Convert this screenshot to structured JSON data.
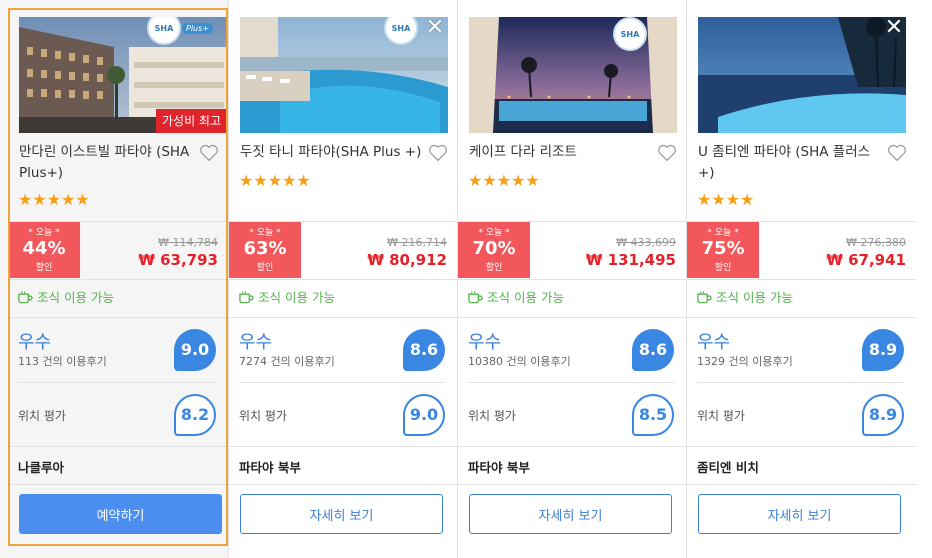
{
  "hotels": [
    {
      "name": "만다린 이스트빌 파타야 (SHA Plus+)",
      "stars": "★★★★★",
      "ribbon": "가성비 최고",
      "deal_today": "* 오늘 *",
      "deal_pct": "44%",
      "deal_off": "할인",
      "price_original": "₩ 114,784",
      "price_final": "₩ 63,793",
      "breakfast": "조식 이용 가능",
      "rating_word": "우수",
      "reviews": "113 건의 이용후기",
      "score": "9.0",
      "location_label": "위치 평가",
      "location_score": "8.2",
      "area": "나클루아",
      "button": "예약하기"
    },
    {
      "name": "두짓 타니 파타야(SHA Plus +)",
      "stars": "★★★★★",
      "deal_today": "* 오늘 *",
      "deal_pct": "63%",
      "deal_off": "할인",
      "price_original": "₩ 216,714",
      "price_final": "₩ 80,912",
      "breakfast": "조식 이용 가능",
      "rating_word": "우수",
      "reviews": "7274 건의 이용후기",
      "score": "8.6",
      "location_label": "위치 평가",
      "location_score": "9.0",
      "area": "파타야 북부",
      "button": "자세히 보기"
    },
    {
      "name": "케이프 다라 리조트",
      "stars": "★★★★★",
      "deal_today": "* 오늘 *",
      "deal_pct": "70%",
      "deal_off": "할인",
      "price_original": "₩ 433,699",
      "price_final": "₩ 131,495",
      "breakfast": "조식 이용 가능",
      "rating_word": "우수",
      "reviews": "10380 건의 이용후기",
      "score": "8.6",
      "location_label": "위치 평가",
      "location_score": "8.5",
      "area": "파타야 북부",
      "button": "자세히 보기"
    },
    {
      "name": "U 좀티엔 파타야 (SHA 플러스 +)",
      "stars": "★★★★",
      "deal_today": "* 오늘 *",
      "deal_pct": "75%",
      "deal_off": "할인",
      "price_original": "₩ 276,380",
      "price_final": "₩ 67,941",
      "breakfast": "조식 이용 가능",
      "rating_word": "우수",
      "reviews": "1329 건의 이용후기",
      "score": "8.9",
      "location_label": "위치 평가",
      "location_score": "8.9",
      "area": "좀티엔 비치",
      "button": "자세히 보기"
    }
  ],
  "badge": {
    "sha": "SHA",
    "plus": "Plus+"
  },
  "icons": {
    "close": "close-icon",
    "heart": "heart-icon",
    "breakfast": "coffee-cup-icon",
    "star": "star-icon"
  },
  "colors": {
    "accent": "#3a86e3",
    "deal": "#f2575c",
    "price": "#e4222a",
    "breakfast": "#55b24d",
    "selected_border": "#f0a33a",
    "stars": "#f6a019"
  }
}
